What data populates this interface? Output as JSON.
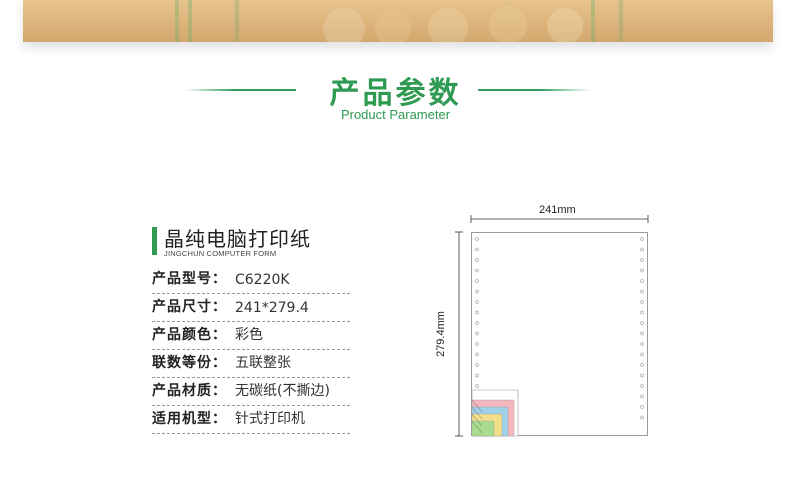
{
  "section": {
    "title_cn": "产品参数",
    "title_en": "Product Parameter"
  },
  "product": {
    "name": "晶纯电脑打印纸",
    "name_en": "JINGCHUN COMPUTER FORM"
  },
  "specs": [
    {
      "key": "产品型号：",
      "value": "C6220K"
    },
    {
      "key": "产品尺寸：",
      "value": "241*279.4"
    },
    {
      "key": "产品颜色：",
      "value": "彩色"
    },
    {
      "key": "联数等份：",
      "value": "五联整张"
    },
    {
      "key": "产品材质：",
      "value": "无碳纸(不撕边)"
    },
    {
      "key": "适用机型：",
      "value": "针式打印机"
    }
  ],
  "diagram": {
    "width_label": "241mm",
    "height_label": "279.4mm",
    "ply_colors": [
      "#f3b7bd",
      "#9fd2ea",
      "#f3df8a",
      "#a9dc8f",
      "#ffffff"
    ]
  },
  "colors": {
    "accent": "#2e9a52",
    "banner": "#dcb47c"
  }
}
